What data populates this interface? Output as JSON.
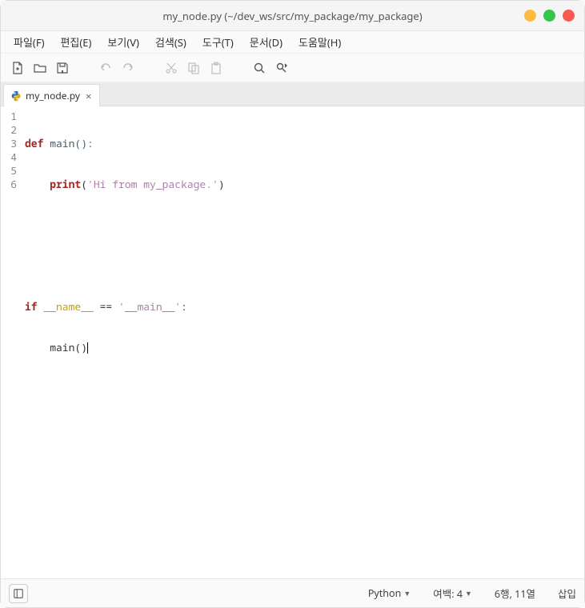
{
  "window": {
    "title": "my_node.py (~/dev_ws/src/my_package/my_package)"
  },
  "menus": {
    "file": "파일(F)",
    "edit": "편집(E)",
    "view": "보기(V)",
    "search": "검색(S)",
    "tools": "도구(T)",
    "documents": "문서(D)",
    "help": "도움말(H)"
  },
  "tab": {
    "label": "my_node.py"
  },
  "code": {
    "lines": [
      {
        "n": "1"
      },
      {
        "n": "2"
      },
      {
        "n": "3"
      },
      {
        "n": "4"
      },
      {
        "n": "5"
      },
      {
        "n": "6"
      }
    ],
    "l1_def": "def",
    "l1_main": " main():",
    "l2_indent": "    ",
    "l2_print": "print",
    "l2_paren1": "(",
    "l2_str": "'Hi from my_package.'",
    "l2_paren2": ")",
    "l5_if": "if",
    "l5_name": " __name__ ",
    "l5_eq": "==",
    "l5_sp": " ",
    "l5_main": "'__main__'",
    "l5_colon": ":",
    "l6_indent": "    ",
    "l6_call": "main()"
  },
  "status": {
    "language": "Python",
    "tab_width_label": "여백: 4",
    "position": "6행, 11열",
    "mode": "삽입"
  }
}
